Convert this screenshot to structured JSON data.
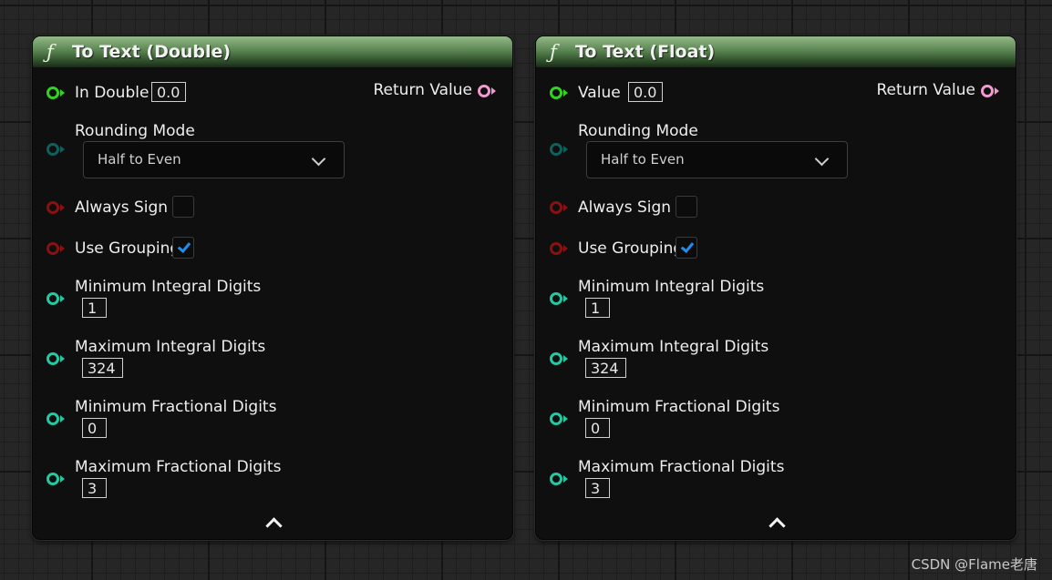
{
  "nodes": [
    {
      "title": "To Text (Double)",
      "func_icon": "ƒ",
      "input": {
        "label": "In Double",
        "value": "0.0"
      },
      "return_label": "Return Value",
      "rounding_mode": {
        "label": "Rounding Mode",
        "value": "Half to Even"
      },
      "always_sign": {
        "label": "Always Sign",
        "checked": false
      },
      "use_grouping": {
        "label": "Use Grouping",
        "checked": true
      },
      "min_integral": {
        "label": "Minimum Integral Digits",
        "value": "1"
      },
      "max_integral": {
        "label": "Maximum Integral Digits",
        "value": "324"
      },
      "min_fractional": {
        "label": "Minimum Fractional Digits",
        "value": "0"
      },
      "max_fractional": {
        "label": "Maximum Fractional Digits",
        "value": "3"
      }
    },
    {
      "title": "To Text (Float)",
      "func_icon": "ƒ",
      "input": {
        "label": "Value",
        "value": "0.0"
      },
      "return_label": "Return Value",
      "rounding_mode": {
        "label": "Rounding Mode",
        "value": "Half to Even"
      },
      "always_sign": {
        "label": "Always Sign",
        "checked": false
      },
      "use_grouping": {
        "label": "Use Grouping",
        "checked": true
      },
      "min_integral": {
        "label": "Minimum Integral Digits",
        "value": "1"
      },
      "max_integral": {
        "label": "Maximum Integral Digits",
        "value": "324"
      },
      "min_fractional": {
        "label": "Minimum Fractional Digits",
        "value": "0"
      },
      "max_fractional": {
        "label": "Maximum Fractional Digits",
        "value": "3"
      }
    }
  ],
  "pin_colors": {
    "exec_float": "#2fd41e",
    "enum": "#0f5f5c",
    "bool": "#8a1111",
    "int": "#22c9a2",
    "text": "#f09acf"
  },
  "header_color": "#5b8552",
  "checkbox_tick_color": "#1e8ef0",
  "watermark": "CSDN @Flame老唐"
}
